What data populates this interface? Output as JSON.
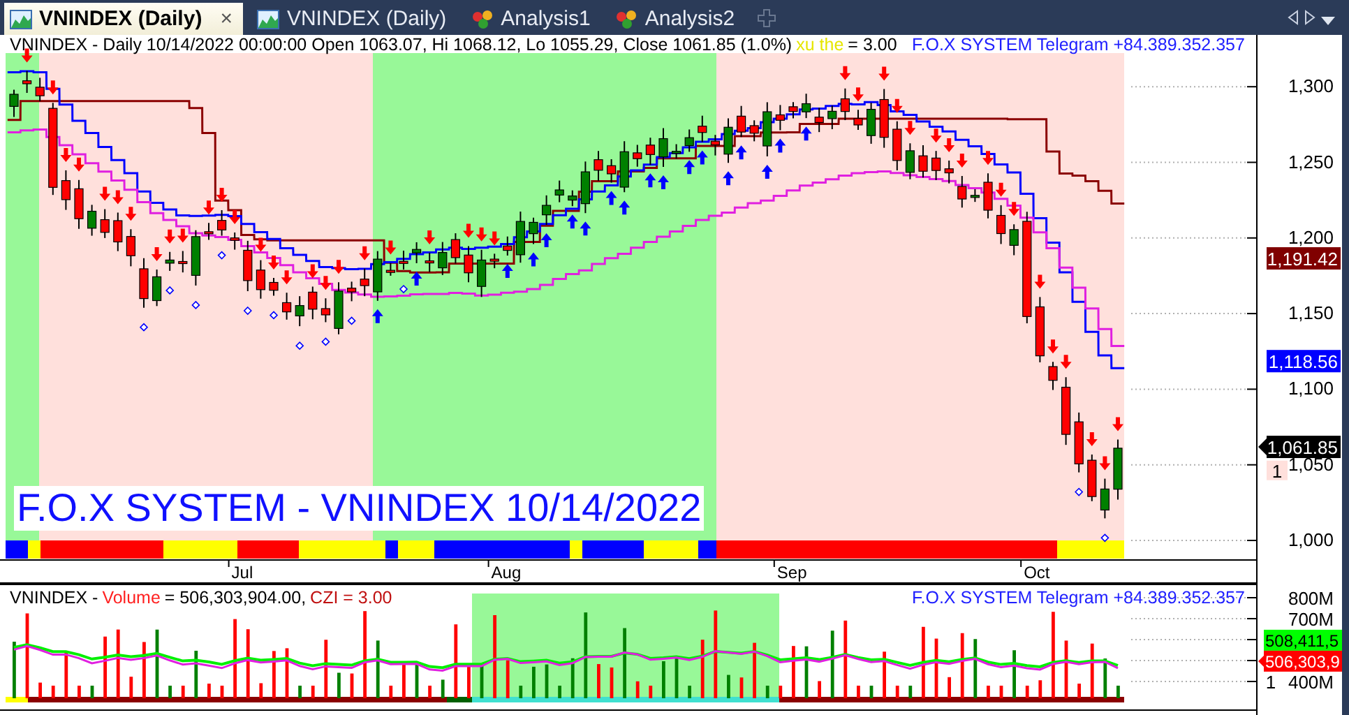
{
  "tabs": [
    {
      "label": "VNINDEX (Daily)",
      "kind": "chart",
      "selected": true,
      "close": "×"
    },
    {
      "label": "VNINDEX (Daily)",
      "kind": "chart",
      "selected": false
    },
    {
      "label": "Analysis1",
      "kind": "analysis",
      "selected": false
    },
    {
      "label": "Analysis2",
      "kind": "analysis",
      "selected": false
    }
  ],
  "price_panel": {
    "header": "VNINDEX - Daily 10/14/2022 00:00:00 Open 1063.07, Hi 1068.12, Lo 1055.29, Close 1061.85 (1.0%)",
    "indicator_name": "xu the",
    "indicator_value": "= 3.00",
    "telegram": "F.O.X SYSTEM Telegram +84.389.352.357",
    "caption": "F.O.X SYSTEM - VNINDEX 10/14/2022",
    "y_ticks": [
      "1,300",
      "1,250",
      "1,200",
      "1,150",
      "1,100",
      "1,050",
      "1,000"
    ],
    "tags": [
      {
        "text": "1,191.42",
        "color": "#800000"
      },
      {
        "text": "1,118.56",
        "color": "#0000ff"
      },
      {
        "text": "1,061.85",
        "color": "#000000"
      },
      {
        "text": "1",
        "color": "#ffe0dc"
      }
    ],
    "months": [
      "Jul",
      "Aug",
      "Sep",
      "Oct"
    ]
  },
  "volume_panel": {
    "symbol": "VNINDEX -",
    "series_name": "Volume",
    "reading": "= 506,303,904.00,",
    "indicator": "CZI = 3.00",
    "telegram": "F.O.X SYSTEM Telegram +84.389.352.357",
    "y_ticks": [
      "800M",
      "700M",
      "400M"
    ],
    "tags": [
      {
        "text": "508,411,5",
        "color": "#00ff00"
      },
      {
        "text": "506,303,9",
        "color": "#ff0000"
      },
      {
        "text": "1",
        "color": "#ffffff"
      }
    ]
  }
}
